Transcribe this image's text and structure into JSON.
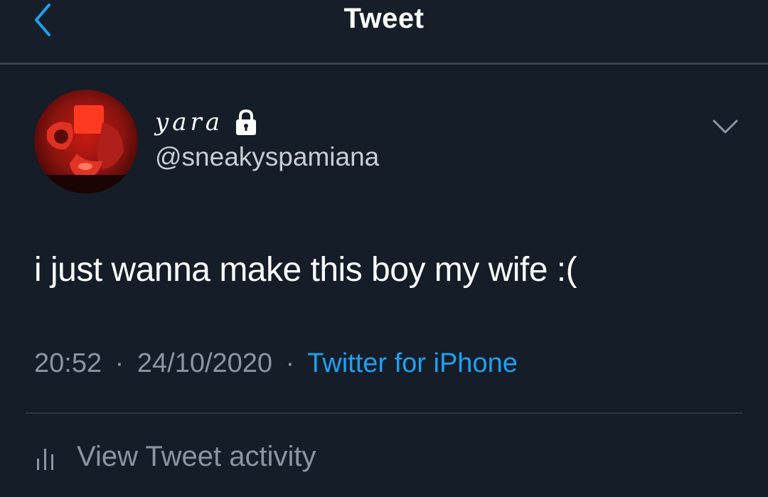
{
  "header": {
    "back_icon": "chevron-left-icon",
    "title": "Tweet"
  },
  "author": {
    "display_name": "yara",
    "protected_icon": "lock-icon",
    "handle": "@sneakyspamiana"
  },
  "tweet": {
    "text": "i just wanna make this boy my wife :(",
    "time": "20:52",
    "date": "24/10/2020",
    "separator": "·",
    "source": "Twitter for iPhone"
  },
  "actions": {
    "more_icon": "chevron-down-icon",
    "activity_icon": "bar-chart-icon",
    "activity_label": "View Tweet activity"
  },
  "colors": {
    "background": "#141d28",
    "accent": "#1da1f2",
    "secondary_text": "#8a96a3",
    "divider": "#38444d"
  }
}
